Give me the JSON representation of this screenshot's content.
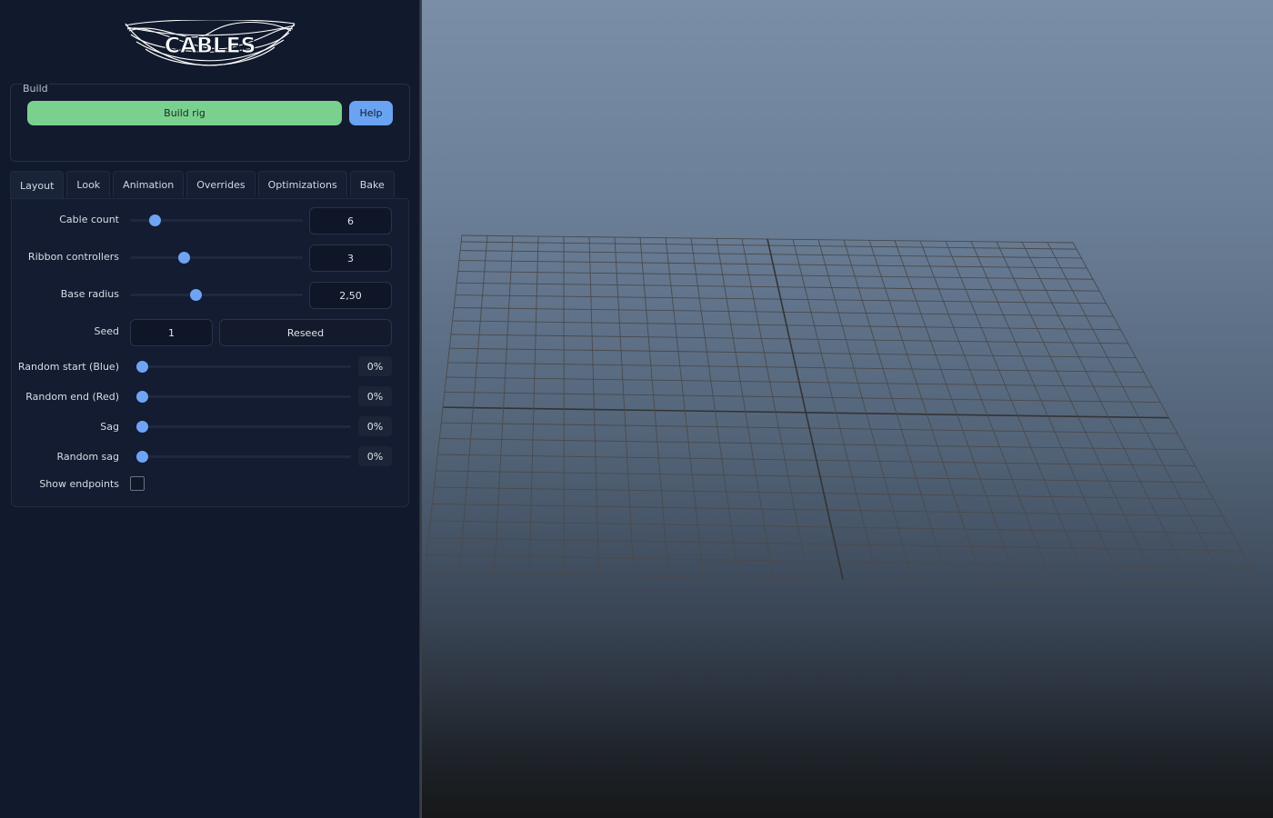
{
  "logo": {
    "text": "CABLES"
  },
  "build": {
    "title": "Build",
    "build_label": "Build rig",
    "help_label": "Help"
  },
  "tabs": [
    {
      "label": "Layout",
      "active": true
    },
    {
      "label": "Look",
      "active": false
    },
    {
      "label": "Animation",
      "active": false
    },
    {
      "label": "Overrides",
      "active": false
    },
    {
      "label": "Optimizations",
      "active": false
    },
    {
      "label": "Bake",
      "active": false
    }
  ],
  "layout": {
    "cable_count": {
      "label": "Cable count",
      "value": "6",
      "slider_fraction": 0.12
    },
    "ribbon_controllers": {
      "label": "Ribbon controllers",
      "value": "3",
      "slider_fraction": 0.3
    },
    "base_radius": {
      "label": "Base radius",
      "value": "2,50",
      "slider_fraction": 0.37
    },
    "seed": {
      "label": "Seed",
      "value": "1",
      "reseed_label": "Reseed"
    },
    "random_start": {
      "label": "Random start (Blue)",
      "value": "0%",
      "slider_fraction": 0
    },
    "random_end": {
      "label": "Random end (Red)",
      "value": "0%",
      "slider_fraction": 0
    },
    "sag": {
      "label": "Sag",
      "value": "0%",
      "slider_fraction": 0
    },
    "random_sag": {
      "label": "Random sag",
      "value": "0%",
      "slider_fraction": 0
    },
    "show_endpoints": {
      "label": "Show endpoints",
      "checked": false
    }
  },
  "colors": {
    "build_button": "#7ad18f",
    "help_button": "#6aa3f2",
    "slider_thumb": "#6fa4f5",
    "grid_line": "#4a4a4c",
    "grid_axis": "#333335"
  }
}
